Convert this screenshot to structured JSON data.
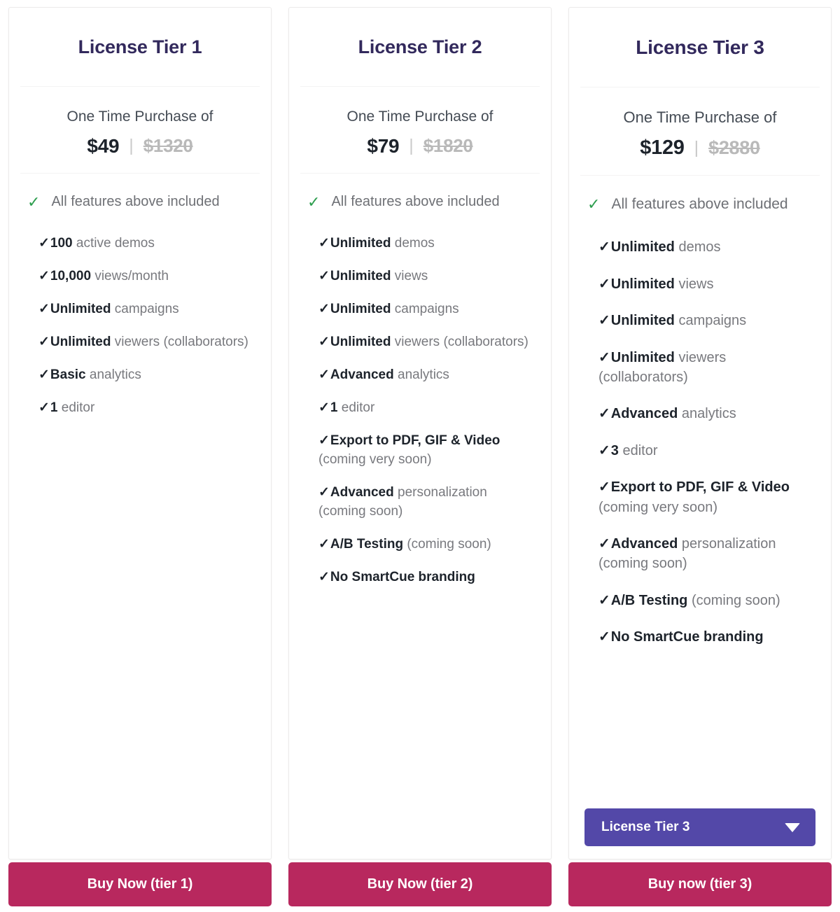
{
  "tiers": [
    {
      "title": "License Tier 1",
      "price_caption": "One Time Purchase of",
      "price_current": "$49",
      "price_separator": "|",
      "price_old": "$1320",
      "lead_feature": "All features above included",
      "features": [
        {
          "strong": "100",
          "rest": " active demos"
        },
        {
          "strong": "10,000",
          "rest": " views/month"
        },
        {
          "strong": "Unlimited",
          "rest": " campaigns"
        },
        {
          "strong": "Unlimited",
          "rest": " viewers (collaborators)"
        },
        {
          "strong": "Basic",
          "rest": " analytics"
        },
        {
          "strong": "1",
          "rest": " editor"
        }
      ],
      "buy_label": "Buy Now (tier 1)",
      "has_select": false
    },
    {
      "title": "License Tier 2",
      "price_caption": "One Time Purchase of",
      "price_current": "$79",
      "price_separator": "|",
      "price_old": "$1820",
      "lead_feature": "All features above included",
      "features": [
        {
          "strong": "Unlimited",
          "rest": " demos"
        },
        {
          "strong": "Unlimited",
          "rest": " views"
        },
        {
          "strong": "Unlimited",
          "rest": " campaigns"
        },
        {
          "strong": "Unlimited",
          "rest": " viewers (collaborators)"
        },
        {
          "strong": "Advanced",
          "rest": " analytics"
        },
        {
          "strong": "1",
          "rest": " editor"
        },
        {
          "strong": "Export to PDF, GIF & Video",
          "rest": " (coming very soon)"
        },
        {
          "strong": "Advanced",
          "rest": " personalization (coming soon)"
        },
        {
          "strong": "A/B Testing",
          "rest": " (coming soon)"
        },
        {
          "strong": "No SmartCue branding",
          "rest": ""
        }
      ],
      "buy_label": "Buy Now (tier 2)",
      "has_select": false
    },
    {
      "title": "License Tier 3",
      "price_caption": "One Time Purchase of",
      "price_current": "$129",
      "price_separator": "|",
      "price_old": "$2880",
      "lead_feature": "All features above included",
      "features": [
        {
          "strong": "Unlimited",
          "rest": " demos"
        },
        {
          "strong": "Unlimited",
          "rest": " views"
        },
        {
          "strong": "Unlimited",
          "rest": " campaigns"
        },
        {
          "strong": "Unlimited",
          "rest": " viewers (collaborators)"
        },
        {
          "strong": "Advanced",
          "rest": " analytics"
        },
        {
          "strong": "3",
          "rest": " editor"
        },
        {
          "strong": "Export to PDF, GIF & Video",
          "rest": " (coming very soon)"
        },
        {
          "strong": "Advanced",
          "rest": " personalization (coming soon)"
        },
        {
          "strong": "A/B Testing",
          "rest": " (coming soon)"
        },
        {
          "strong": "No SmartCue branding",
          "rest": ""
        }
      ],
      "buy_label": "Buy now (tier 3)",
      "has_select": true,
      "select_label": "License Tier 3",
      "select_icon": "chevron-down-icon"
    }
  ],
  "icons": {
    "lead_check": "✓",
    "feature_tick": "✓"
  },
  "colors": {
    "title": "#32295c",
    "buy_button": "#b8285e",
    "select": "#5348a8",
    "lead_check": "#2e9e4f",
    "card_bg": "#ffffff"
  }
}
